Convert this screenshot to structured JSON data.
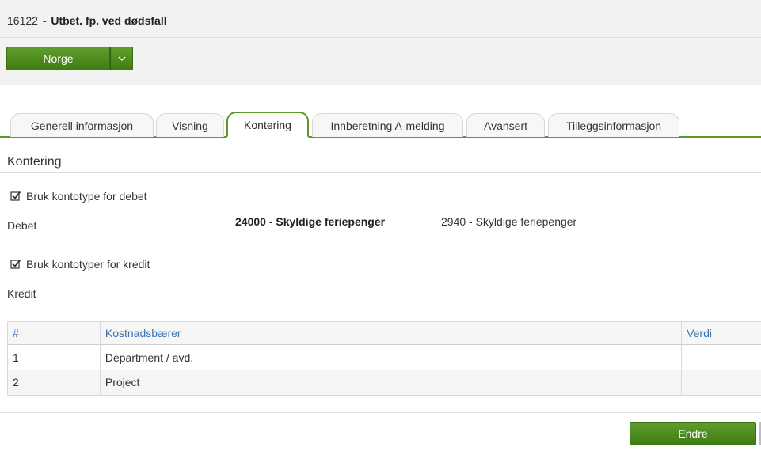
{
  "header": {
    "code": "16122",
    "separator": "-",
    "title": "Utbet. fp. ved dødsfall"
  },
  "country_button": {
    "label": "Norge",
    "caret_icon": "chevron-down-icon"
  },
  "tabs": [
    {
      "label": "Generell informasjon",
      "active": false
    },
    {
      "label": "Visning",
      "active": false
    },
    {
      "label": "Kontering",
      "active": true
    },
    {
      "label": "Innberetning A-melding",
      "active": false
    },
    {
      "label": "Avansert",
      "active": false
    },
    {
      "label": "Tilleggsinformasjon",
      "active": false
    }
  ],
  "section": {
    "title": "Kontering",
    "debit_checkbox": {
      "label": "Bruk kontotype for debet",
      "checked": true
    },
    "debit_label": "Debet",
    "debit_account": "24000 - Skyldige feriepenger",
    "debit_account_type": "2940 - Skyldige feriepenger",
    "credit_checkbox": {
      "label": "Bruk kontotyper for kredit",
      "checked": true
    },
    "credit_label": "Kredit"
  },
  "table": {
    "headers": [
      "#",
      "Kostnadsbærer",
      "Verdi"
    ],
    "rows": [
      [
        "1",
        "Department / avd.",
        ""
      ],
      [
        "2",
        "Project",
        ""
      ]
    ]
  },
  "footer": {
    "edit_label": "Endre"
  },
  "colors": {
    "accent_green": "#4a8a1c",
    "link_blue": "#3a73b4"
  }
}
